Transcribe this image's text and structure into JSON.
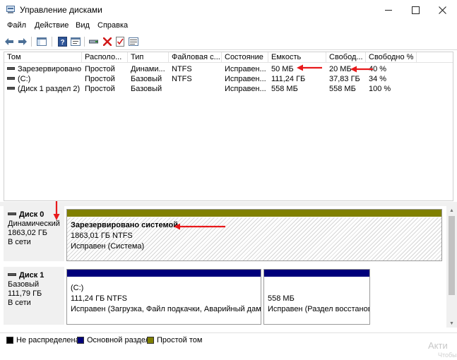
{
  "window": {
    "title": "Управление дисками"
  },
  "menu": [
    "Файл",
    "Действие",
    "Вид",
    "Справка"
  ],
  "toolbar": {
    "icons": [
      "back-arrow-icon",
      "forward-arrow-icon",
      "console-tree-icon",
      "help-icon",
      "properties-icon",
      "connect-icon",
      "delete-icon",
      "checkmark-icon",
      "details-icon"
    ]
  },
  "volumes": {
    "columns": [
      "Том",
      "Располо...",
      "Тип",
      "Файловая с...",
      "Состояние",
      "Емкость",
      "Свобод...",
      "Свободно %"
    ],
    "rows": [
      [
        "Зарезервировано...",
        "Простой",
        "Динами...",
        "NTFS",
        "Исправен...",
        "50 МБ",
        "20 МБ",
        "40 %"
      ],
      [
        "(C:)",
        "Простой",
        "Базовый",
        "NTFS",
        "Исправен...",
        "111,24 ГБ",
        "37,83 ГБ",
        "34 %"
      ],
      [
        "(Диск 1 раздел 2)",
        "Простой",
        "Базовый",
        "",
        "Исправен...",
        "558 МБ",
        "558 МБ",
        "100 %"
      ]
    ]
  },
  "disks": [
    {
      "name": "Диск 0",
      "type": "Динамический",
      "size": "1863,02 ГБ",
      "status": "В сети",
      "partitions": [
        {
          "title": "Зарезервировано системой",
          "size": "1863,01 ГБ NTFS",
          "status": "Исправен (Система)",
          "bar_color": "#808000"
        }
      ]
    },
    {
      "name": "Диск 1",
      "type": "Базовый",
      "size": "111,79 ГБ",
      "status": "В сети",
      "partitions": [
        {
          "title": "(C:)",
          "size": "111,24 ГБ NTFS",
          "status": "Исправен (Загрузка, Файл подкачки, Аварийный дамп п",
          "bar_color": "#00007b"
        },
        {
          "title": "",
          "size": "558 МБ",
          "status": "Исправен (Раздел восстанова",
          "bar_color": "#00007b"
        }
      ]
    }
  ],
  "legend": [
    {
      "label": "Не распределена",
      "color": "#000000"
    },
    {
      "label": "Основной раздел",
      "color": "#00007b"
    },
    {
      "label": "Простой том",
      "color": "#808000"
    }
  ],
  "watermark": {
    "line1": "Акти",
    "line2": "Чтобы"
  },
  "colors": {
    "annotation_arrow": "#e8191b"
  }
}
